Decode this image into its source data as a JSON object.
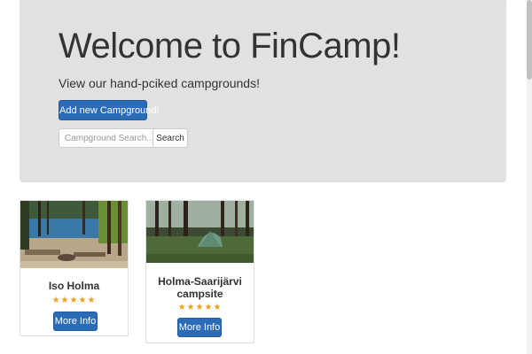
{
  "hero": {
    "title": "Welcome to FinCamp!",
    "subtitle": "View our hand-pciked campgrounds!",
    "add_button_label": "Add new Campground!"
  },
  "search": {
    "placeholder": "Campground Search...",
    "button_label": "Search"
  },
  "campgrounds": [
    {
      "name": "Iso Holma",
      "rating_stars": "★★★★★",
      "rating": 5,
      "button_label": "More Info",
      "image": "lake-shore-firepit"
    },
    {
      "name": "Holma-Saarijärvi campsite",
      "rating_stars": "★★★★★",
      "rating": 5,
      "button_label": "More Info",
      "image": "forest-tent"
    }
  ],
  "colors": {
    "primary": "#2b6cb8",
    "jumbotron": "#e3e3e3",
    "star": "#f0a11a"
  }
}
